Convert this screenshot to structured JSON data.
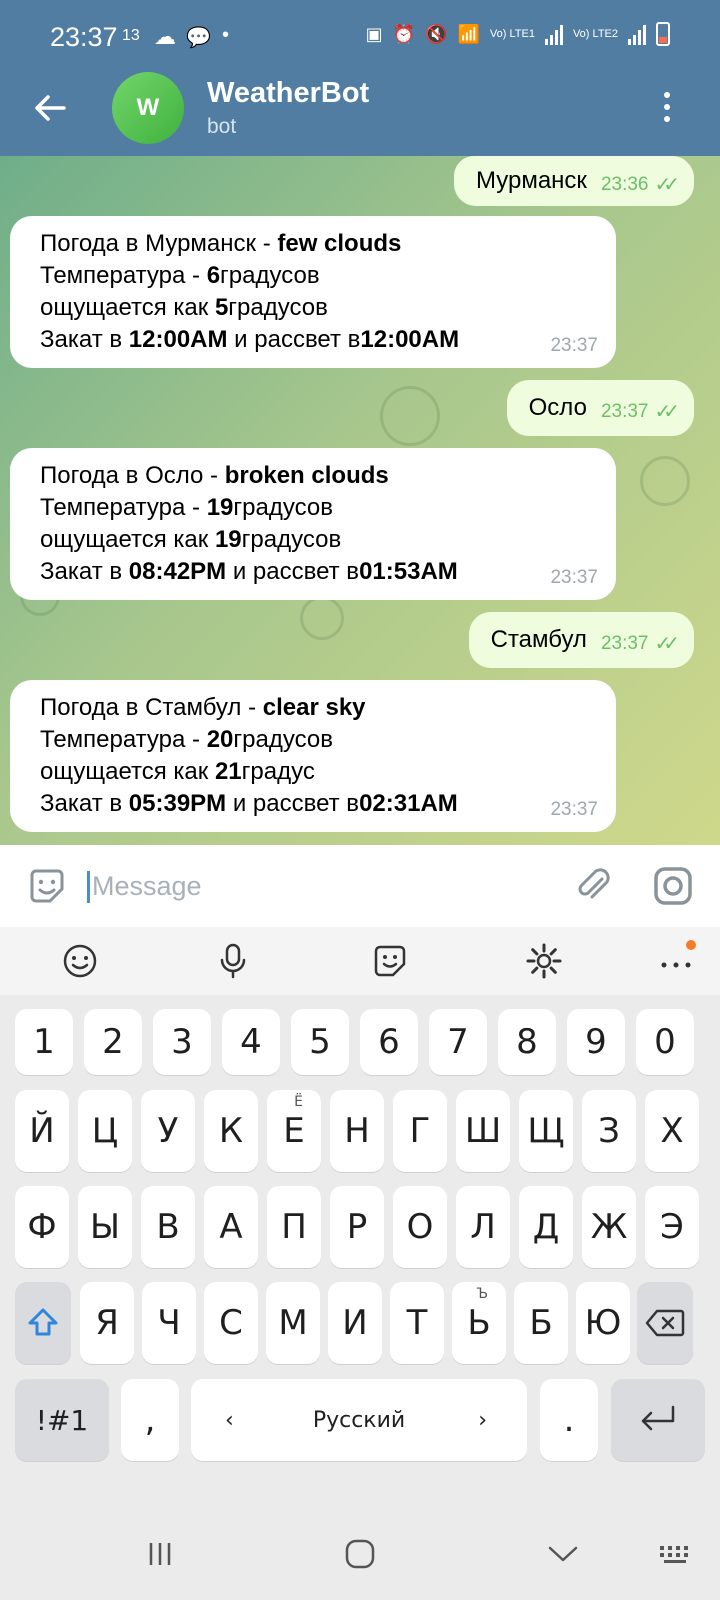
{
  "status": {
    "time": "23:37",
    "extra": "13",
    "sim1": "Vo) LTE1",
    "sim2": "Vo) LTE2"
  },
  "header": {
    "title": "WeatherBot",
    "subtitle": "bot",
    "avatar_letter": "W"
  },
  "messages": [
    {
      "dir": "out",
      "text": "Мурманск",
      "time": "23:36"
    },
    {
      "dir": "in",
      "time": "23:37",
      "line1_a": "Погода в Мурманск - ",
      "line1_b": "few clouds",
      "line2_a": "Температура - ",
      "line2_b": "6",
      "line2_c": "градусов",
      "line3_a": "ощущается как ",
      "line3_b": "5",
      "line3_c": "градусов",
      "line4_a": "Закат в ",
      "line4_b": "12:00AM",
      "line4_c": " и рассвет в",
      "line4_d": "12:00AM"
    },
    {
      "dir": "out",
      "text": "Осло",
      "time": "23:37"
    },
    {
      "dir": "in",
      "time": "23:37",
      "line1_a": "Погода в Осло - ",
      "line1_b": "broken clouds",
      "line2_a": "Температура - ",
      "line2_b": "19",
      "line2_c": "градусов",
      "line3_a": "ощущается как ",
      "line3_b": "19",
      "line3_c": "градусов",
      "line4_a": "Закат в ",
      "line4_b": "08:42PM",
      "line4_c": " и рассвет в",
      "line4_d": "01:53AM"
    },
    {
      "dir": "out",
      "text": "Стамбул",
      "time": "23:37"
    },
    {
      "dir": "in",
      "time": "23:37",
      "line1_a": "Погода в Стамбул - ",
      "line1_b": "clear sky",
      "line2_a": "Температура - ",
      "line2_b": "20",
      "line2_c": "градусов",
      "line3_a": "ощущается как ",
      "line3_b": "21",
      "line3_c": "градус",
      "line4_a": "Закат в ",
      "line4_b": "05:39PM",
      "line4_c": " и рассвет в",
      "line4_d": "02:31AM"
    }
  ],
  "input": {
    "placeholder": "Message"
  },
  "keyboard": {
    "row_numbers": [
      "1",
      "2",
      "3",
      "4",
      "5",
      "6",
      "7",
      "8",
      "9",
      "0"
    ],
    "row1": [
      "Й",
      "Ц",
      "У",
      "К",
      "Е",
      "Н",
      "Г",
      "Ш",
      "Щ",
      "З",
      "Х"
    ],
    "row1_alt_e": "Ё",
    "row2": [
      "Ф",
      "Ы",
      "В",
      "А",
      "П",
      "Р",
      "О",
      "Л",
      "Д",
      "Ж",
      "Э"
    ],
    "row3": [
      "Я",
      "Ч",
      "С",
      "М",
      "И",
      "Т",
      "Ь",
      "Б",
      "Ю"
    ],
    "row3_alt_soft": "Ъ",
    "symbols_key": "!#1",
    "comma_key": ",",
    "space_label": "Русский",
    "period_key": "."
  },
  "colors": {
    "header": "#517da2",
    "outgoing": "#effdde",
    "check": "#6cbf6a"
  }
}
